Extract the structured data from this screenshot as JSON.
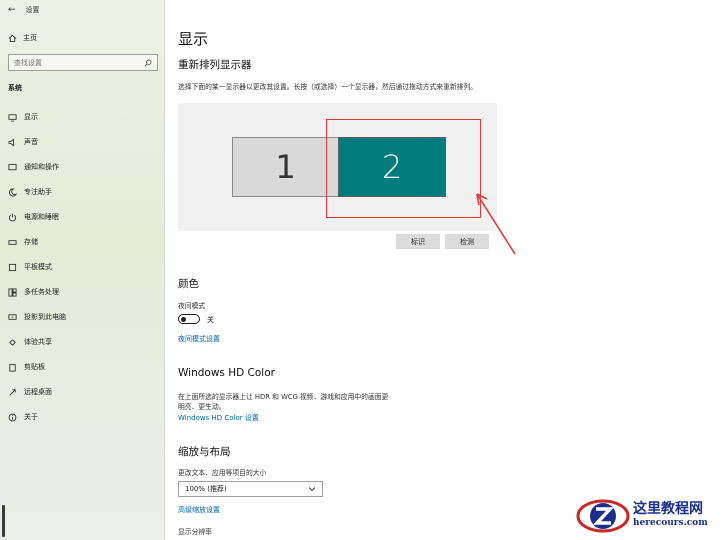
{
  "window": {
    "app_title": "设置"
  },
  "sidebar": {
    "home_label": "主页",
    "search_placeholder": "查找设置",
    "section_label": "系统",
    "items": [
      {
        "label": "显示",
        "icon": "display-icon",
        "selected": true
      },
      {
        "label": "声音",
        "icon": "speaker-icon"
      },
      {
        "label": "通知和操作",
        "icon": "notification-icon"
      },
      {
        "label": "专注助手",
        "icon": "moon-icon"
      },
      {
        "label": "电源和睡眠",
        "icon": "power-icon"
      },
      {
        "label": "存储",
        "icon": "storage-icon"
      },
      {
        "label": "平板模式",
        "icon": "tablet-icon"
      },
      {
        "label": "多任务处理",
        "icon": "multitask-icon"
      },
      {
        "label": "投影到此电脑",
        "icon": "project-icon"
      },
      {
        "label": "体验共享",
        "icon": "share-icon"
      },
      {
        "label": "剪贴板",
        "icon": "clipboard-icon"
      },
      {
        "label": "远程桌面",
        "icon": "remote-icon"
      },
      {
        "label": "关于",
        "icon": "info-icon"
      }
    ]
  },
  "main": {
    "page_title": "显示",
    "rearrange": {
      "heading": "重新排列显示器",
      "description": "选择下面的某一显示器以更改其设置。长按（或选择）一个显示器，然后通过拖动方式来重新排列。",
      "monitors": [
        "1",
        "2"
      ],
      "identify_label": "标识",
      "detect_label": "检测"
    },
    "color": {
      "heading": "颜色",
      "night_light_label": "夜间模式",
      "night_light_state": "关",
      "night_light_settings_link": "夜间模式设置"
    },
    "hdr": {
      "heading": "Windows HD Color",
      "description_line1": "在上面所选的显示器上让 HDR 和 WCG 视频、游戏和应用中的画面更",
      "description_line2": "明亮、更生动。",
      "settings_link": "Windows HD Color 设置"
    },
    "scale": {
      "heading": "缩放与布局",
      "size_label": "更改文本、应用等项目的大小",
      "size_value": "100% (推荐)",
      "advanced_link": "高级缩放设置",
      "resolution_label": "显示分辨率"
    }
  },
  "watermark": {
    "title": "这里教程网",
    "url": "herecours.com"
  },
  "colors": {
    "accent": "#0063b1",
    "selected_monitor": "#007c7c",
    "highlight": "#e03b3b"
  }
}
